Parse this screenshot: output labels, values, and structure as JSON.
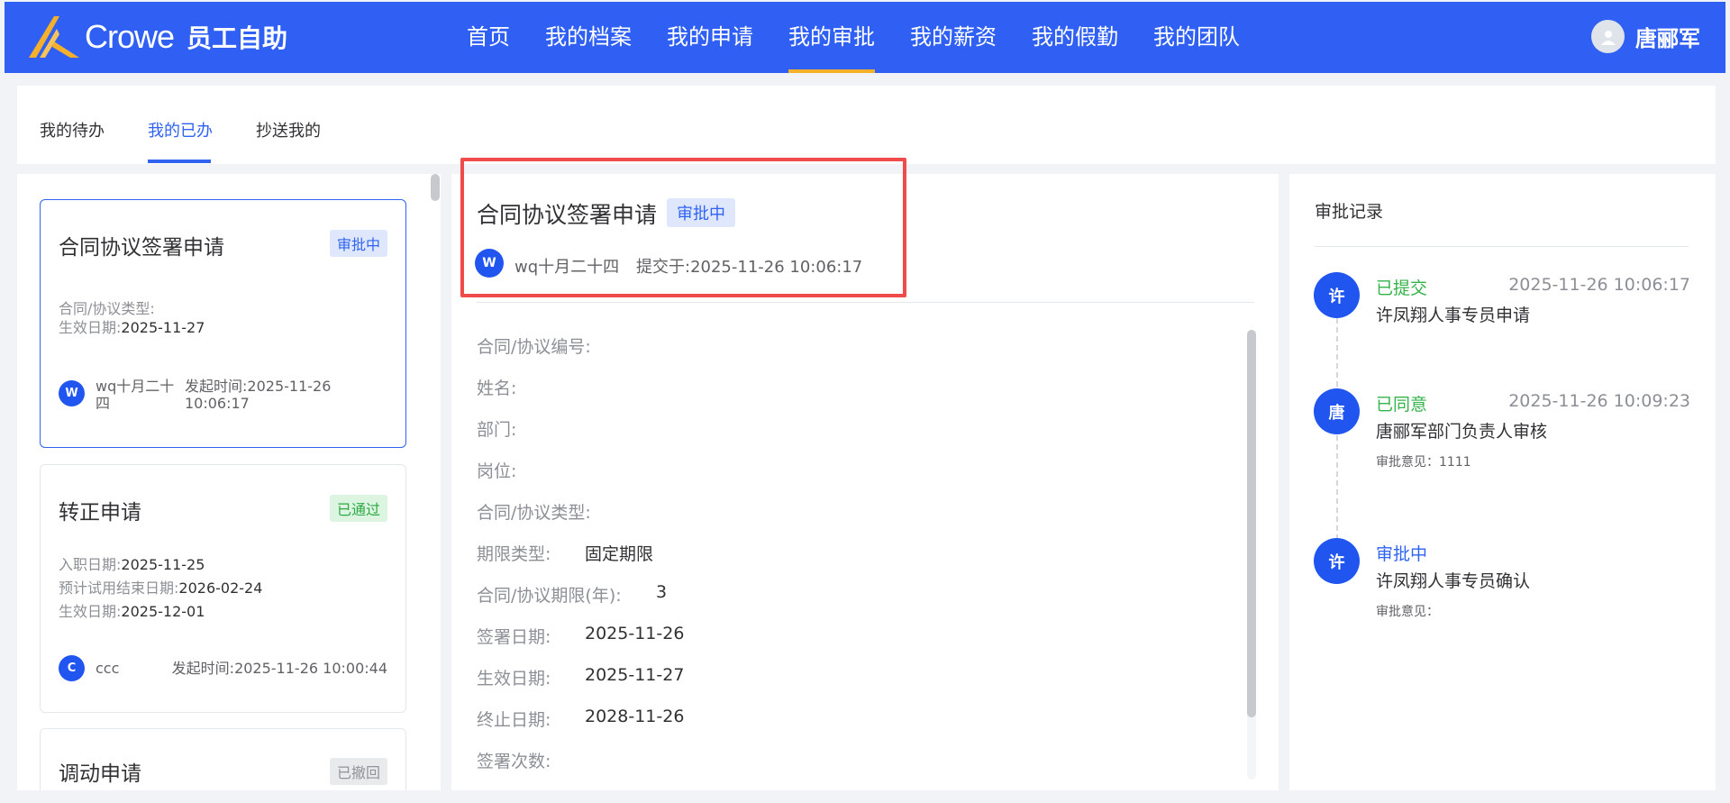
{
  "header": {
    "brand_name": "Crowe",
    "app_name": "员工自助",
    "nav": [
      "首页",
      "我的档案",
      "我的申请",
      "我的审批",
      "我的薪资",
      "我的假勤",
      "我的团队"
    ],
    "active_nav": "我的审批",
    "user_name": "唐郦军",
    "colors": {
      "header_bg": "#3060f3",
      "active_underline": "#f4b02a"
    }
  },
  "tabs": [
    "我的待办",
    "我的已办",
    "抄送我的"
  ],
  "active_tab": "我的已办",
  "list": [
    {
      "title": "合同协议签署申请",
      "status": "审批中",
      "fields": [
        {
          "label": "合同/协议类型:",
          "value": ""
        },
        {
          "label": "生效日期:",
          "value": "2025-11-27"
        }
      ],
      "avatar": "W",
      "submitter_line1": "wq十月二十",
      "submitter_line2": "四",
      "time_label": "发起时间:",
      "time_line1": "2025-11-26",
      "time_line2": "10:06:17"
    },
    {
      "title": "转正申请",
      "status": "已通过",
      "fields": [
        {
          "label": "入职日期:",
          "value": "2025-11-25"
        },
        {
          "label": "预计试用结束日期:",
          "value": "2026-02-24"
        },
        {
          "label": "生效日期:",
          "value": "2025-12-01"
        }
      ],
      "avatar": "C",
      "submitter": "ccc",
      "time_label": "发起时间:",
      "time": "2025-11-26 10:00:44"
    },
    {
      "title": "调动申请",
      "status": "已撤回"
    }
  ],
  "detail": {
    "title": "合同协议签署申请",
    "status": "审批中",
    "avatar": "W",
    "submitter": "wq十月二十四",
    "submitted_label": "提交于:",
    "submitted_at": "2025-11-26 10:06:17",
    "fields": [
      {
        "label": "合同/协议编号:",
        "value": ""
      },
      {
        "label": "姓名:",
        "value": ""
      },
      {
        "label": "部门:",
        "value": ""
      },
      {
        "label": "岗位:",
        "value": ""
      },
      {
        "label": "合同/协议类型:",
        "value": ""
      },
      {
        "label": "期限类型:",
        "value": "固定期限"
      },
      {
        "label": "合同/协议期限(年):",
        "value": "3"
      },
      {
        "label": "签署日期:",
        "value": "2025-11-26"
      },
      {
        "label": "生效日期:",
        "value": "2025-11-27"
      },
      {
        "label": "终止日期:",
        "value": "2028-11-26"
      },
      {
        "label": "签署次数:",
        "value": ""
      }
    ]
  },
  "records": {
    "title": "审批记录",
    "items": [
      {
        "avatar": "许",
        "status": "已提交",
        "status_color": "green",
        "time": "2025-11-26 10:06:17",
        "desc": "许凤翔人事专员申请",
        "note": ""
      },
      {
        "avatar": "唐",
        "status": "已同意",
        "status_color": "green",
        "time": "2025-11-26 10:09:23",
        "desc": "唐郦军部门负责人审核",
        "note": "审批意见：1111"
      },
      {
        "avatar": "许",
        "status": "审批中",
        "status_color": "blue",
        "time": "",
        "desc": "许凤翔人事专员确认",
        "note": "审批意见："
      }
    ]
  }
}
